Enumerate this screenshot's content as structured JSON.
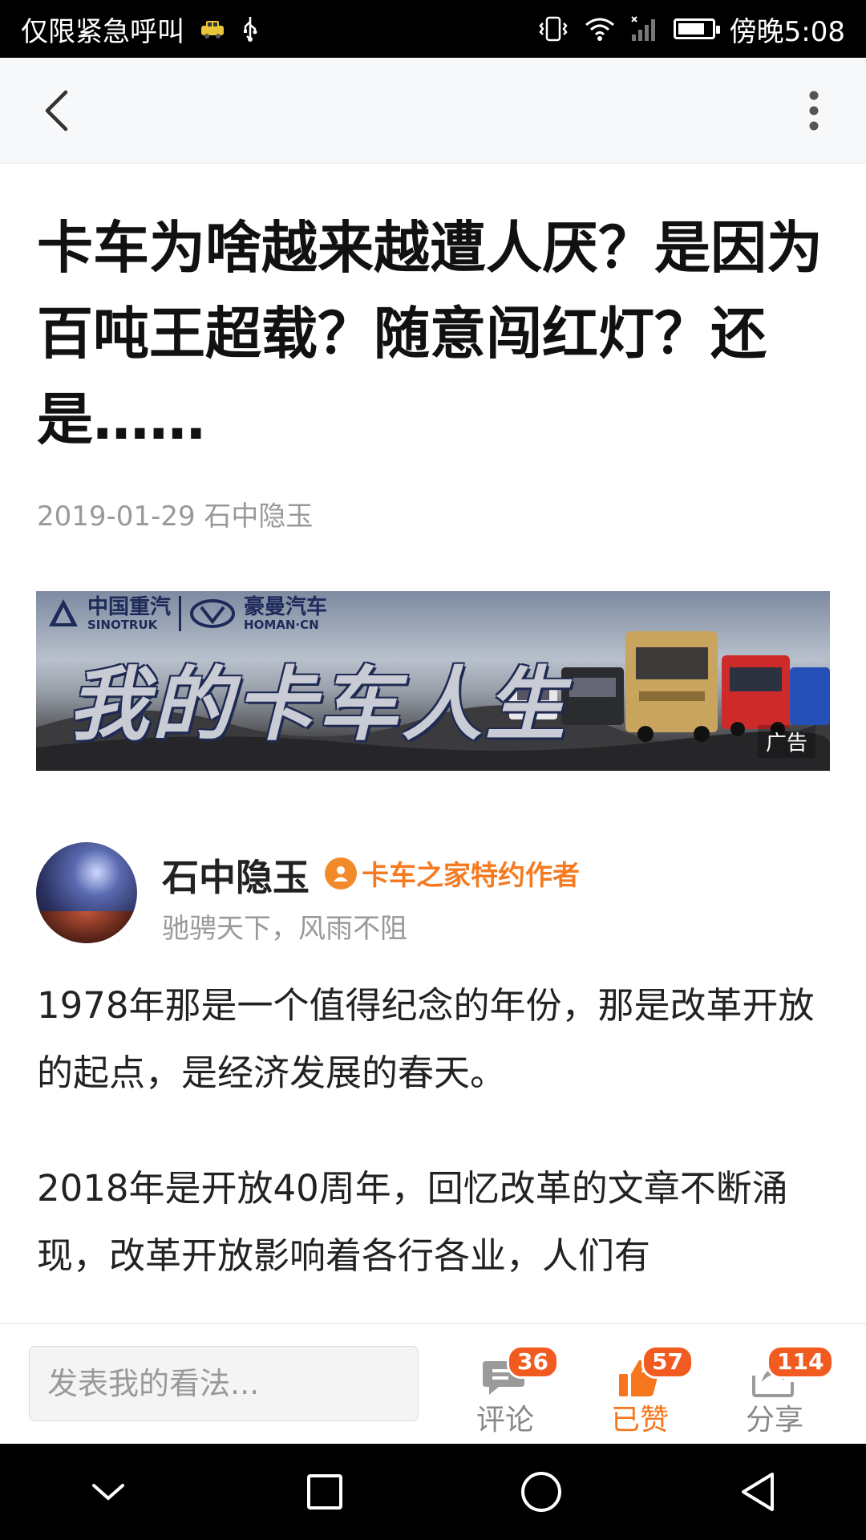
{
  "status_bar": {
    "left_text": "仅限紧急呼叫",
    "time": "傍晚5:08",
    "icons": [
      "taxi-icon",
      "usb-icon",
      "vibrate-icon",
      "wifi-icon",
      "signal-icon",
      "battery-icon"
    ]
  },
  "topbar": {
    "back_icon": "chevron-left-icon",
    "more_icon": "more-vertical-icon"
  },
  "article": {
    "title": "卡车为啥越来越遭人厌？是因为百吨王超载？随意闯红灯？还是……",
    "date": "2019-01-29",
    "source": "石中隐玉",
    "ad": {
      "brand_1": "中国重汽",
      "brand_1_en": "SINOTRUK",
      "brand_2": "豪曼汽车",
      "brand_2_en": "HOMAN·CN",
      "slogan": "我的卡车人生",
      "label": "广告"
    },
    "author": {
      "name": "石中隐玉",
      "badge": "卡车之家特约作者",
      "motto": "驰骋天下，风雨不阻"
    },
    "paragraphs": [
      "1978年那是一个值得纪念的年份，那是改革开放的起点，是经济发展的春天。",
      "2018年是开放40周年，回忆改革的文章不断涌现，改革开放影响着各行各业，人们有"
    ]
  },
  "bottom_bar": {
    "comment_placeholder": "发表我的看法...",
    "actions": [
      {
        "label": "评论",
        "count": "36",
        "icon": "comment-icon"
      },
      {
        "label": "已赞",
        "count": "57",
        "icon": "thumbs-up-icon"
      },
      {
        "label": "分享",
        "count": "114",
        "icon": "share-icon"
      }
    ]
  },
  "nav_bar": {
    "icons": [
      "collapse-down-icon",
      "recents-square-icon",
      "home-circle-icon",
      "back-triangle-icon"
    ]
  },
  "colors": {
    "accent_orange": "#f6761d",
    "badge_red": "#f25b1f",
    "status_bar": "#000000",
    "title_text": "#111111"
  }
}
